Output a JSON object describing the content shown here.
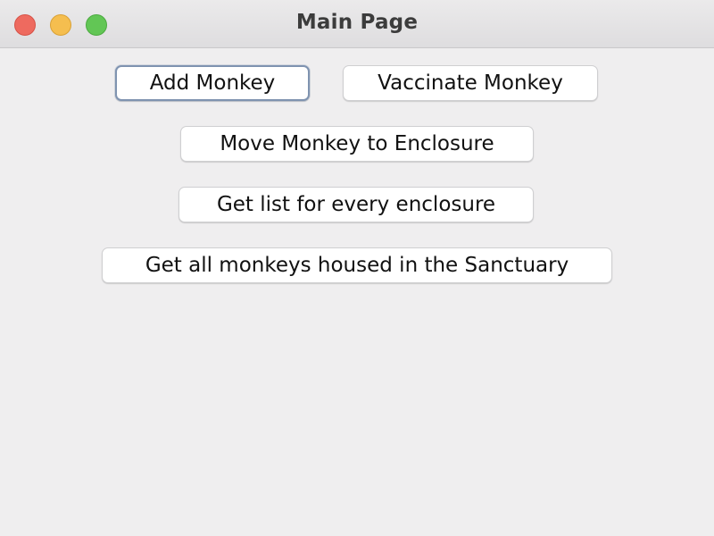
{
  "window": {
    "title": "Main Page"
  },
  "buttons": {
    "add_monkey": "Add Monkey",
    "vaccinate_monkey": "Vaccinate Monkey",
    "move_monkey": "Move Monkey to Enclosure",
    "list_every_enclosure": "Get list for every enclosure",
    "all_monkeys_sanctuary": "Get all monkeys housed in the Sanctuary"
  },
  "colors": {
    "close": "#ee6a5f",
    "minimize": "#f5be4f",
    "zoom": "#62c655",
    "focus_ring": "#7f93b0"
  }
}
